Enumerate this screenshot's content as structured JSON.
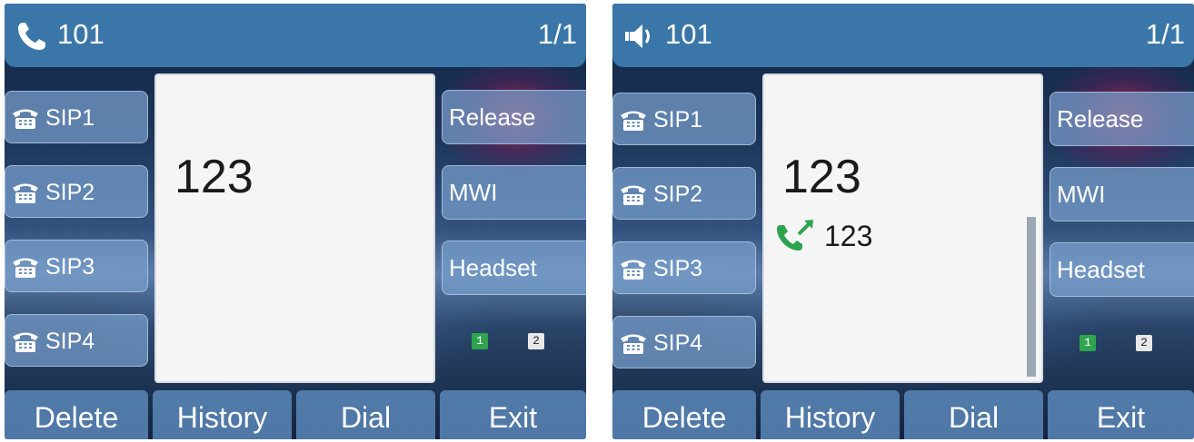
{
  "left_phone": {
    "title": {
      "icon": "handset-icon",
      "number": "101",
      "page": "1/1"
    },
    "line_keys": [
      {
        "icon": "desk-phone-icon",
        "label": "SIP1"
      },
      {
        "icon": "desk-phone-icon",
        "label": "SIP2"
      },
      {
        "icon": "desk-phone-icon",
        "label": "SIP3"
      },
      {
        "icon": "desk-phone-icon",
        "label": "SIP4"
      }
    ],
    "right_keys": [
      "Release",
      "MWI",
      "Headset"
    ],
    "display": {
      "dialed_number": "123"
    },
    "account_badges": [
      "1",
      "2"
    ],
    "softkeys": [
      "Delete",
      "History",
      "Dial",
      "Exit"
    ]
  },
  "right_phone": {
    "title": {
      "icon": "speaker-icon",
      "number": "101",
      "page": "1/1"
    },
    "line_keys": [
      {
        "icon": "desk-phone-icon",
        "label": "SIP1"
      },
      {
        "icon": "desk-phone-icon",
        "label": "SIP2"
      },
      {
        "icon": "desk-phone-icon",
        "label": "SIP3"
      },
      {
        "icon": "desk-phone-icon",
        "label": "SIP4"
      }
    ],
    "right_keys": [
      "Release",
      "MWI",
      "Headset"
    ],
    "display": {
      "dialed_number": "123",
      "suggestion_icon": "outgoing-call-icon",
      "suggestion_number": "123"
    },
    "account_badges": [
      "1",
      "2"
    ],
    "softkeys": [
      "Delete",
      "History",
      "Dial",
      "Exit"
    ]
  },
  "colors": {
    "title_bar": "#3a77a8",
    "key_bg": "#78a0cd",
    "outgoing_call_green": "#2ea44f"
  }
}
